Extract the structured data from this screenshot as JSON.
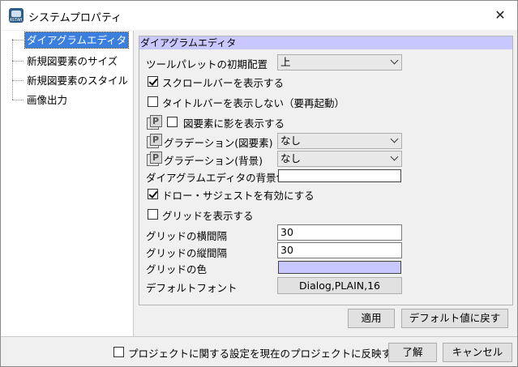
{
  "window": {
    "title": "システムプロパティ",
    "icon_text": "ASTAH"
  },
  "tree": {
    "items": [
      {
        "label": "ダイアグラムエディタ",
        "selected": true
      },
      {
        "label": "新規図要素のサイズ",
        "selected": false
      },
      {
        "label": "新規図要素のスタイル",
        "selected": false
      },
      {
        "label": "画像出力",
        "selected": false
      }
    ]
  },
  "panel": {
    "header": "ダイアグラムエディタ",
    "palette_label": "ツールパレットの初期配置",
    "palette_value": "上",
    "show_scrollbar": {
      "label": "スクロールバーを表示する",
      "checked": true
    },
    "hide_titlebar": {
      "label": "タイトルバーを表示しない（要再起動）",
      "checked": false
    },
    "show_shadow": {
      "label": "図要素に影を表示する",
      "checked": false
    },
    "gradation_element_label": "グラデーション(図要素)",
    "gradation_element_value": "なし",
    "gradation_bg_label": "グラデーション(背景)",
    "gradation_bg_value": "なし",
    "bg_color_label": "ダイアグラムエディタの背景色",
    "bg_color": "#ffffff",
    "draw_suggest": {
      "label": "ドロー・サジェストを有効にする",
      "checked": true
    },
    "show_grid": {
      "label": "グリッドを表示する",
      "checked": false
    },
    "grid_h_label": "グリッドの横間隔",
    "grid_h_value": "30",
    "grid_v_label": "グリッドの縦間隔",
    "grid_v_value": "30",
    "grid_color_label": "グリッドの色",
    "grid_color": "#c8c8ff",
    "default_font_label": "デフォルトフォント",
    "default_font_value": "Dialog,PLAIN,16"
  },
  "buttons": {
    "apply": "適用",
    "reset_default": "デフォルト値に戻す",
    "ok": "了解",
    "cancel": "キャンセル"
  },
  "footer": {
    "reflect_project": {
      "label": "プロジェクトに関する設定を現在のプロジェクトに反映する",
      "checked": false
    }
  }
}
